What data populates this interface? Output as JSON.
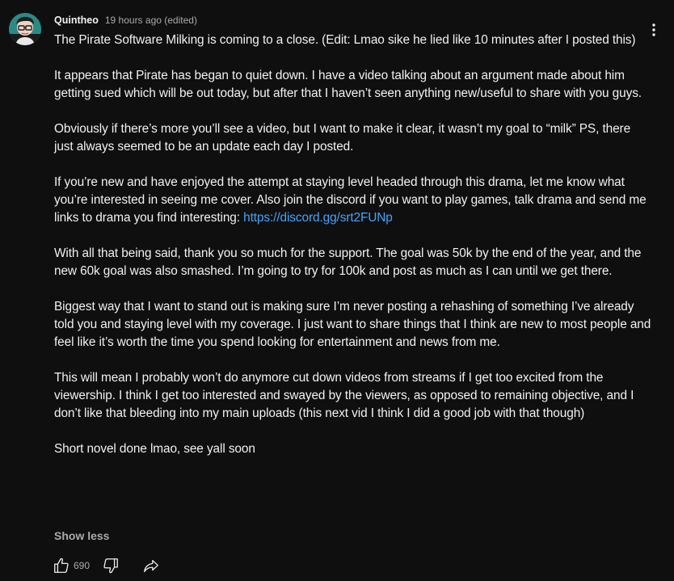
{
  "post": {
    "author": "Quintheo",
    "timestamp": "19 hours ago (edited)",
    "paragraphs": [
      "The Pirate Software Milking is coming to a close. (Edit: Lmao sike he lied like 10 minutes after I posted this)",
      "It appears that Pirate has began to quiet down. I have a video talking about an argument made about him getting sued which will be out today, but after that I haven’t seen anything new/useful to share with you guys.",
      "Obviously if there’s more you’ll see a video, but I want to make it clear, it wasn’t my goal to “milk” PS, there just always seemed to be an update each day I posted.",
      "If you’re new and have enjoyed the attempt at staying level headed through this drama, let me know what you’re interested in seeing me cover. Also join the discord if you want to play games, talk drama and send me links to drama you find interesting: ",
      "With all that being said, thank you so much for the support. The goal was 50k by the end of the year, and the new 60k goal was also smashed. I’m going to try for 100k and post as much as I can until we get there.",
      "Biggest way that I want to stand out is making sure I’m never posting a rehashing of something I’ve already told you and staying level with my coverage. I just want to share things that I think are new to most people and feel like it’s worth the time you spend looking for entertainment and news from me.",
      "This will mean I probably won’t do anymore cut down videos from streams if I get too excited from the viewership. I think I get too interested and swayed by the viewers, as opposed to remaining objective, and I don’t like that bleeding into my main uploads (this next vid I think I did a good job with that though)",
      "Short novel done lmao, see yall soon"
    ],
    "discord_link": "https://discord.gg/srt2FUNp",
    "show_less_label": "Show less",
    "like_count": "690"
  },
  "icons": {
    "avatar": "avatar",
    "menu": "more-vertical-icon",
    "like": "thumbs-up-icon",
    "dislike": "thumbs-down-icon",
    "share": "share-icon"
  },
  "colors": {
    "background": "#0f0f0f",
    "text": "#f1f1f1",
    "secondary_text": "#aaaaaa",
    "link": "#3ea6ff"
  }
}
